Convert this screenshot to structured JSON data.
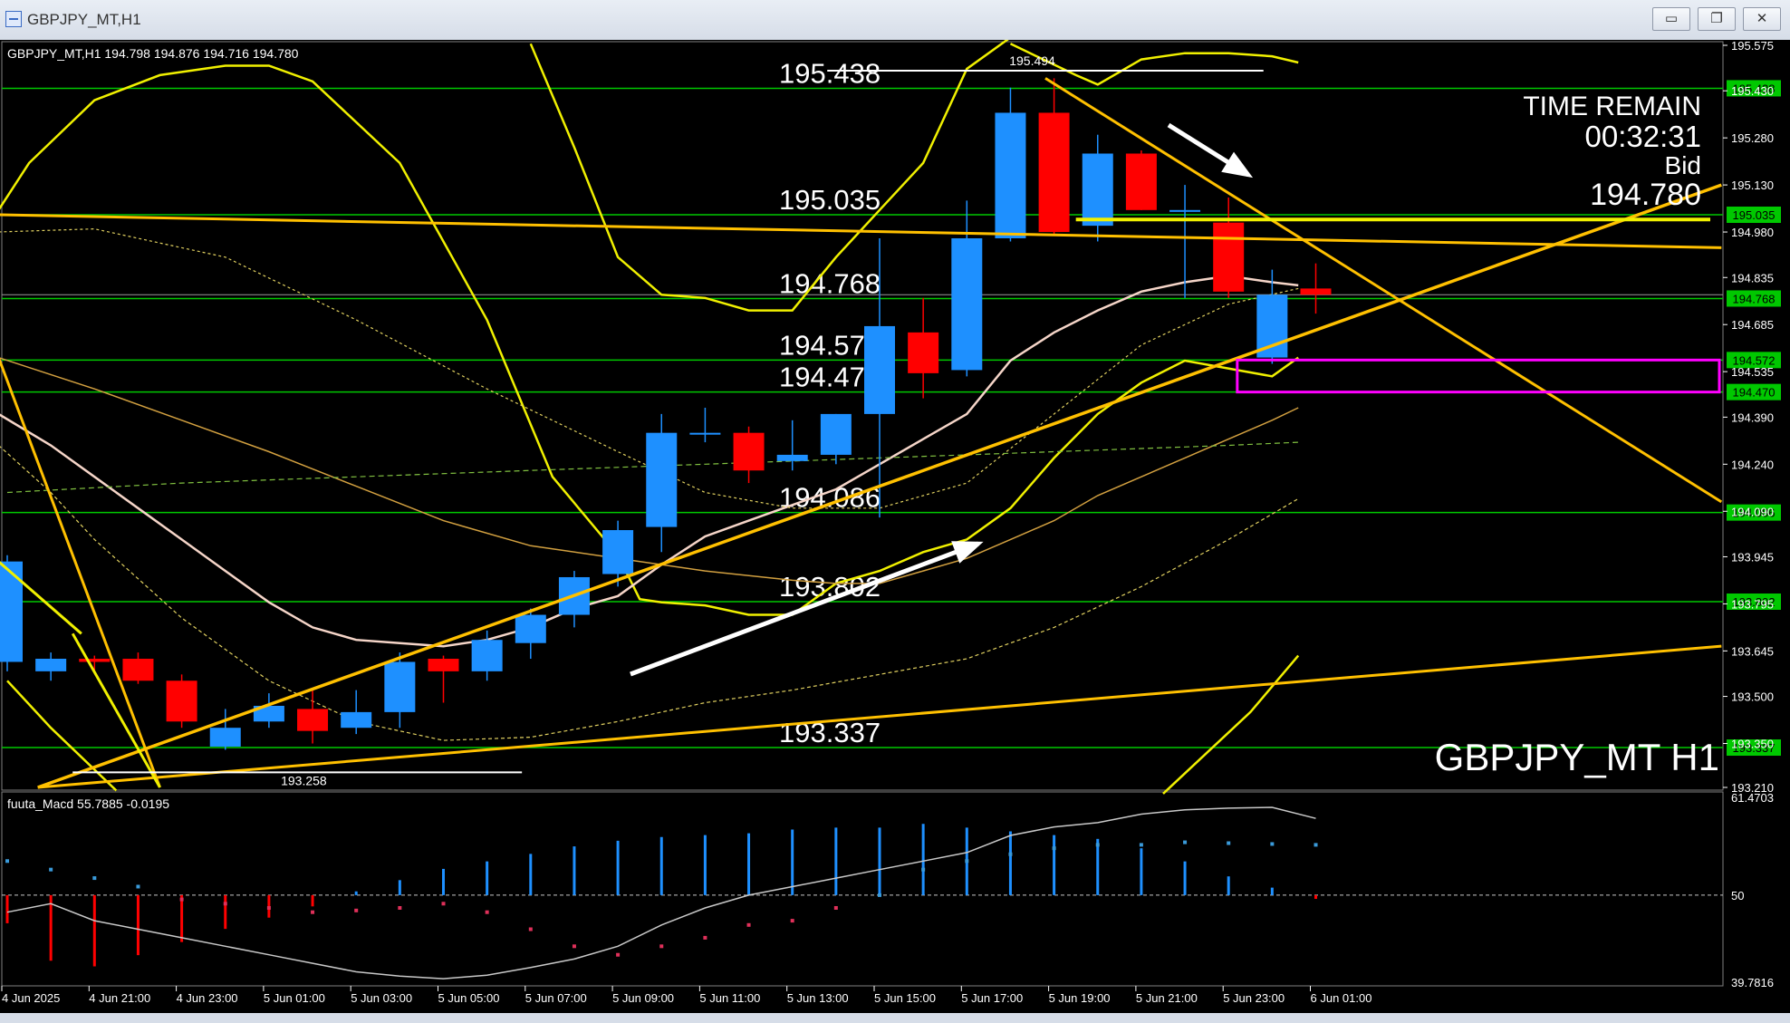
{
  "window": {
    "title": "GBPJPY_MT,H1",
    "minimize_glyph": "▭",
    "restore_glyph": "❐",
    "close_glyph": "✕"
  },
  "chart_header": "GBPJPY_MT,H1  194.798 194.876 194.716 194.780",
  "symbol_label": "GBPJPY_MT H1",
  "time_remain": {
    "label": "TIME REMAIN",
    "value": "00:32:31",
    "bid_label": "Bid",
    "bid_value": "194.780"
  },
  "colors": {
    "bull": "#1e90ff",
    "bear": "#ff0000",
    "level": "#00c800",
    "trend": "#ffc000",
    "band": "#f0f000",
    "ma_main": "#f5d5c8",
    "rect": "#ff00ff",
    "macd_signal": "#c8c8c8"
  },
  "chart_data": {
    "type": "candlestick",
    "ylim": [
      193.21,
      195.575
    ],
    "price_ticks": [
      "195.575",
      "195.430",
      "195.280",
      "195.130",
      "194.980",
      "194.835",
      "194.685",
      "194.535",
      "194.390",
      "194.240",
      "194.090",
      "193.945",
      "193.795",
      "193.645",
      "193.500",
      "193.350",
      "193.210"
    ],
    "time_labels": [
      "4 Jun 2025",
      "4 Jun 21:00",
      "4 Jun 23:00",
      "5 Jun 01:00",
      "5 Jun 03:00",
      "5 Jun 05:00",
      "5 Jun 07:00",
      "5 Jun 09:00",
      "5 Jun 11:00",
      "5 Jun 13:00",
      "5 Jun 15:00",
      "5 Jun 17:00",
      "5 Jun 19:00",
      "5 Jun 21:00",
      "5 Jun 23:00",
      "6 Jun 01:00"
    ],
    "candles": [
      {
        "o": 193.61,
        "h": 193.95,
        "l": 193.58,
        "c": 193.93
      },
      {
        "o": 193.58,
        "h": 193.64,
        "l": 193.55,
        "c": 193.62
      },
      {
        "o": 193.62,
        "h": 193.63,
        "l": 193.58,
        "c": 193.61
      },
      {
        "o": 193.62,
        "h": 193.64,
        "l": 193.54,
        "c": 193.55
      },
      {
        "o": 193.55,
        "h": 193.57,
        "l": 193.4,
        "c": 193.42
      },
      {
        "o": 193.34,
        "h": 193.46,
        "l": 193.33,
        "c": 193.4
      },
      {
        "o": 193.42,
        "h": 193.51,
        "l": 193.4,
        "c": 193.47
      },
      {
        "o": 193.46,
        "h": 193.52,
        "l": 193.35,
        "c": 193.39
      },
      {
        "o": 193.4,
        "h": 193.52,
        "l": 193.38,
        "c": 193.45
      },
      {
        "o": 193.45,
        "h": 193.64,
        "l": 193.4,
        "c": 193.61
      },
      {
        "o": 193.62,
        "h": 193.63,
        "l": 193.48,
        "c": 193.58
      },
      {
        "o": 193.58,
        "h": 193.71,
        "l": 193.55,
        "c": 193.68
      },
      {
        "o": 193.67,
        "h": 193.78,
        "l": 193.62,
        "c": 193.76
      },
      {
        "o": 193.76,
        "h": 193.9,
        "l": 193.72,
        "c": 193.88
      },
      {
        "o": 193.89,
        "h": 194.06,
        "l": 193.85,
        "c": 194.03
      },
      {
        "o": 194.04,
        "h": 194.4,
        "l": 193.96,
        "c": 194.34
      },
      {
        "o": 194.34,
        "h": 194.42,
        "l": 194.31,
        "c": 194.34
      },
      {
        "o": 194.34,
        "h": 194.36,
        "l": 194.18,
        "c": 194.22
      },
      {
        "o": 194.25,
        "h": 194.38,
        "l": 194.22,
        "c": 194.27
      },
      {
        "o": 194.27,
        "h": 194.4,
        "l": 194.24,
        "c": 194.4
      },
      {
        "o": 194.4,
        "h": 194.96,
        "l": 194.07,
        "c": 194.68
      },
      {
        "o": 194.66,
        "h": 194.77,
        "l": 194.45,
        "c": 194.53
      },
      {
        "o": 194.54,
        "h": 195.08,
        "l": 194.52,
        "c": 194.96
      },
      {
        "o": 194.96,
        "h": 195.44,
        "l": 194.95,
        "c": 195.36
      },
      {
        "o": 195.36,
        "h": 195.47,
        "l": 194.97,
        "c": 194.98
      },
      {
        "o": 195.0,
        "h": 195.29,
        "l": 194.95,
        "c": 195.23
      },
      {
        "o": 195.23,
        "h": 195.24,
        "l": 195.05,
        "c": 195.05
      },
      {
        "o": 195.05,
        "h": 195.13,
        "l": 194.77,
        "c": 195.05
      },
      {
        "o": 195.01,
        "h": 195.09,
        "l": 194.77,
        "c": 194.79
      },
      {
        "o": 194.58,
        "h": 194.86,
        "l": 194.56,
        "c": 194.78
      },
      {
        "o": 194.8,
        "h": 194.88,
        "l": 194.72,
        "c": 194.78
      }
    ],
    "levels": [
      {
        "price": 195.438,
        "label": "195.438"
      },
      {
        "price": 195.035,
        "label": "195.035"
      },
      {
        "price": 194.768,
        "label": "194.768"
      },
      {
        "price": 194.572,
        "label": "194.572"
      },
      {
        "price": 194.47,
        "label": "194.470"
      },
      {
        "price": 194.086,
        "label": "194.086"
      },
      {
        "price": 193.802,
        "label": "193.802"
      },
      {
        "price": 193.337,
        "label": "193.337"
      }
    ],
    "swing_high": {
      "price": 195.494,
      "label": "195.494"
    },
    "swing_low": {
      "price": 193.258,
      "label": "193.258"
    },
    "current_price": 194.78,
    "macd": {
      "title": "fuuta_Macd 55.7885  -0.0195",
      "ylim": [
        39.7816,
        61.4703
      ],
      "mid": 50,
      "tick_labels": [
        "61.4703",
        "50",
        "39.7816"
      ],
      "hist": [
        -1.5,
        -3.5,
        -3.8,
        -3.2,
        -2.5,
        -1.8,
        -1.2,
        -0.6,
        0.2,
        0.8,
        1.4,
        1.8,
        2.2,
        2.6,
        2.9,
        3.1,
        3.2,
        3.3,
        3.5,
        3.6,
        3.6,
        3.8,
        3.6,
        3.4,
        3.2,
        3.0,
        2.5,
        1.8,
        1.0,
        0.4,
        -0.2
      ],
      "signal": [
        48,
        49,
        47,
        46,
        45,
        44,
        43,
        42,
        41,
        40.5,
        40.2,
        40.6,
        41.5,
        42.5,
        44,
        46.5,
        48.5,
        50,
        51,
        52,
        53,
        54,
        55,
        57,
        58,
        58.5,
        59.5,
        60,
        60.2,
        60.3,
        59
      ],
      "dots": [
        54,
        53,
        52,
        51,
        49.5,
        49,
        48.5,
        48,
        48.2,
        48.5,
        49,
        48,
        46,
        44,
        43,
        44,
        45,
        46.5,
        47,
        48.5,
        50,
        53,
        54,
        54.8,
        55.5,
        55.9,
        55.9,
        56.2,
        56.1,
        56.0,
        55.9
      ]
    }
  }
}
